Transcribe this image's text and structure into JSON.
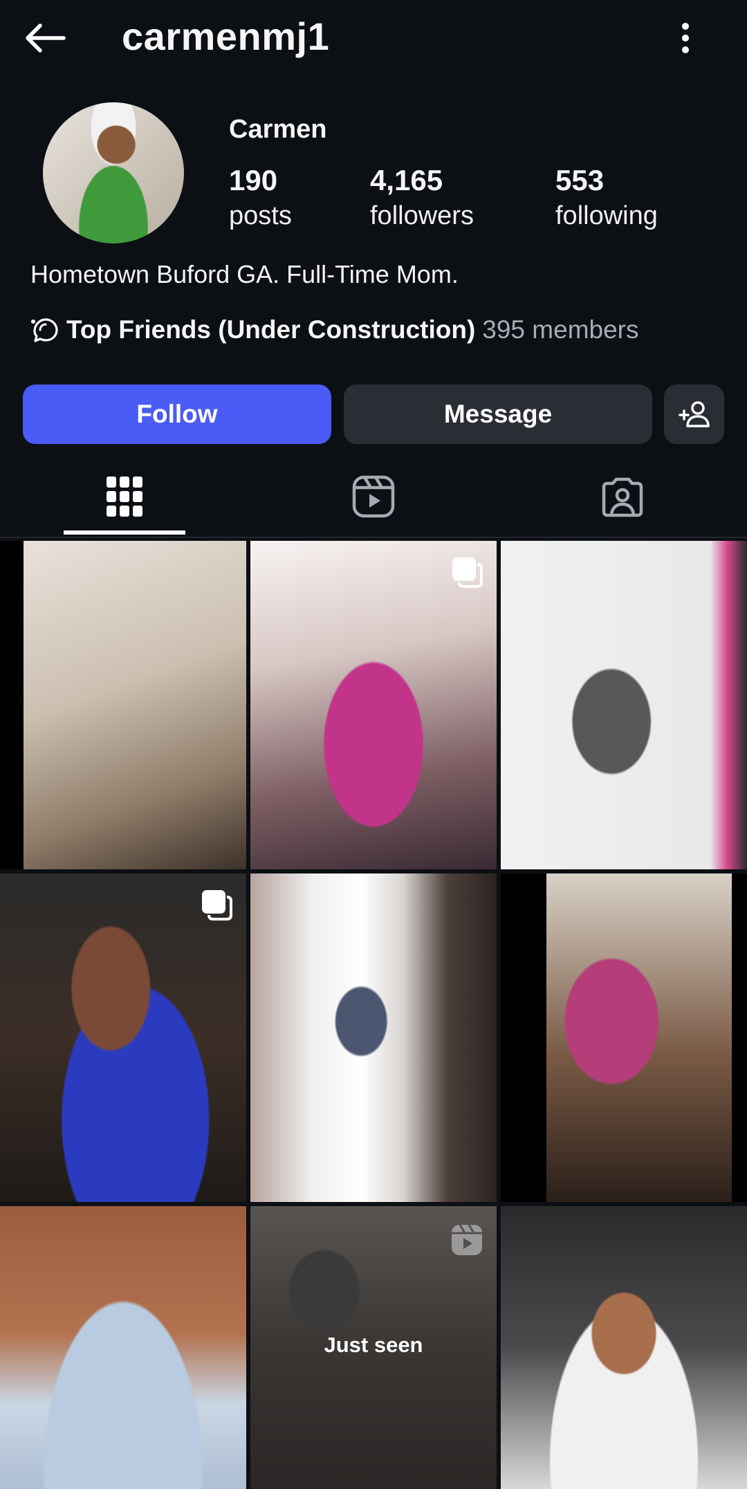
{
  "header": {
    "username": "carmenmj1",
    "back_icon": "arrow-left-icon",
    "more_icon": "more-vertical-icon"
  },
  "profile": {
    "display_name": "Carmen",
    "stats": [
      {
        "value": "190",
        "label": "posts"
      },
      {
        "value": "4,165",
        "label": "followers"
      },
      {
        "value": "553",
        "label": "following"
      }
    ],
    "bio": "Hometown Buford GA.  Full-Time Mom.",
    "channel": {
      "icon": "broadcast-channel-icon",
      "name": "Top Friends (Under Construction)",
      "members": "395 members"
    }
  },
  "actions": {
    "follow_label": "Follow",
    "message_label": "Message",
    "suggest_icon": "add-person-icon",
    "follow_color": "#4a5cf5"
  },
  "tabs": [
    {
      "icon": "grid-icon",
      "active": true
    },
    {
      "icon": "reels-icon",
      "active": false
    },
    {
      "icon": "tagged-icon",
      "active": false
    }
  ],
  "grid": {
    "posts": [
      {
        "badge": null
      },
      {
        "badge": "carousel-icon"
      },
      {
        "badge": null
      },
      {
        "badge": "carousel-icon"
      },
      {
        "badge": null
      },
      {
        "badge": null
      },
      {
        "badge": null
      },
      {
        "badge": "reel-icon",
        "overlay_text": "Just seen"
      },
      {
        "badge": null
      }
    ]
  }
}
